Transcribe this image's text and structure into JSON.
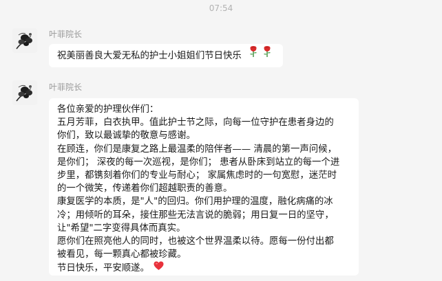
{
  "chat": {
    "timestamp": "07:54",
    "messages": [
      {
        "sender": "叶菲院长",
        "avatar_icon": "ink-flower-avatar",
        "text": "祝美丽善良大爱无私的护士小姐姐们节日快乐",
        "trailing_emoji": [
          "rose-emoji",
          "rose-emoji"
        ]
      },
      {
        "sender": "叶菲院长",
        "avatar_icon": "ink-flower-avatar",
        "lines": [
          "各位亲爱的护理伙伴们：",
          "五月芳菲，白衣执甲。值此护士节之际，向每一位守护在患者身边的",
          "你们，致以最诚挚的敬意与感谢。",
          "在顾连，你们是康复之路上最温柔的陪伴者—— 清晨的第一声问候，",
          "是你们； 深夜的每一次巡视，是你们； 患者从卧床到站立的每一个进",
          "步里，都镌刻着你们的专业与耐心； 家属焦虑时的一句宽慰，迷茫时",
          "的一个微笑，传递着你们超越职责的善意。",
          "康复医学的本质，是\"人\"的回归。你们用护理的温度，融化病痛的冰",
          "冷；用倾听的耳朵，接住那些无法言说的脆弱；用日复一日的坚守，",
          "让\"希望\"二字变得具体而真实。",
          "愿你们在照亮他人的同时，也被这个世界温柔以待。愿每一份付出都",
          "被看见，每一颗真心都被珍藏。",
          "节日快乐，平安顺遂。"
        ],
        "trailing_emoji": [
          "red-heart-emoji"
        ]
      }
    ]
  },
  "colors": {
    "background": "#f5f5f5",
    "bubble": "#ffffff",
    "text": "#1a1a1a",
    "meta_text": "#999999",
    "rose_red": "#d92a2a",
    "heart_red": "#e8323c"
  }
}
